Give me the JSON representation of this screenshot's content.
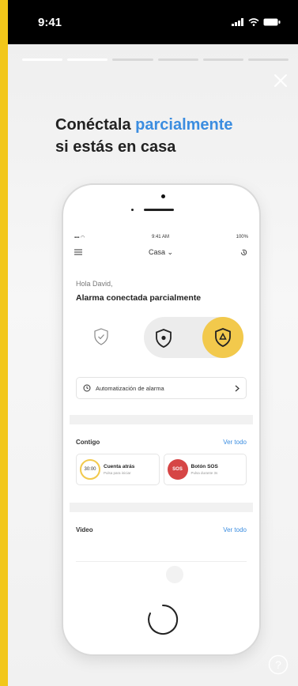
{
  "status_bar": {
    "time": "9:41"
  },
  "colors": {
    "accent": "#3b8de0",
    "brand_yellow": "#f2c71a",
    "sos_red": "#d64545"
  },
  "progress": {
    "segments": 6,
    "active": 2
  },
  "headline": {
    "line1_prefix": "Conéctala ",
    "line1_accent": "parcialmente",
    "line2": "si estás en casa"
  },
  "phone": {
    "mini_status": {
      "time": "9:41 AM",
      "battery": "100%"
    },
    "location": "Casa",
    "greeting": "Hola David,",
    "alarm_status": "Alarma conectada parcialmente",
    "automation_label": "Automatización de alarma",
    "contigo": {
      "title": "Contigo",
      "see_all": "Ver todo",
      "cards": [
        {
          "badge": "30:00",
          "title": "Cuenta atrás",
          "subtitle": "Pulsa para iniciar"
        },
        {
          "badge": "SOS",
          "title": "Botón SOS",
          "subtitle": "Pulsa durante 3s"
        }
      ]
    },
    "video": {
      "title": "Video",
      "see_all": "Ver todo"
    }
  },
  "icons": {
    "close": "close-icon",
    "help": "help-icon",
    "menu": "menu-icon",
    "history": "history-icon",
    "shield_off": "shield-check-icon",
    "shield_total": "shield-icon",
    "shield_partial": "shield-partial-icon",
    "clock": "clock-icon",
    "chevron": "chevron-right-icon"
  }
}
